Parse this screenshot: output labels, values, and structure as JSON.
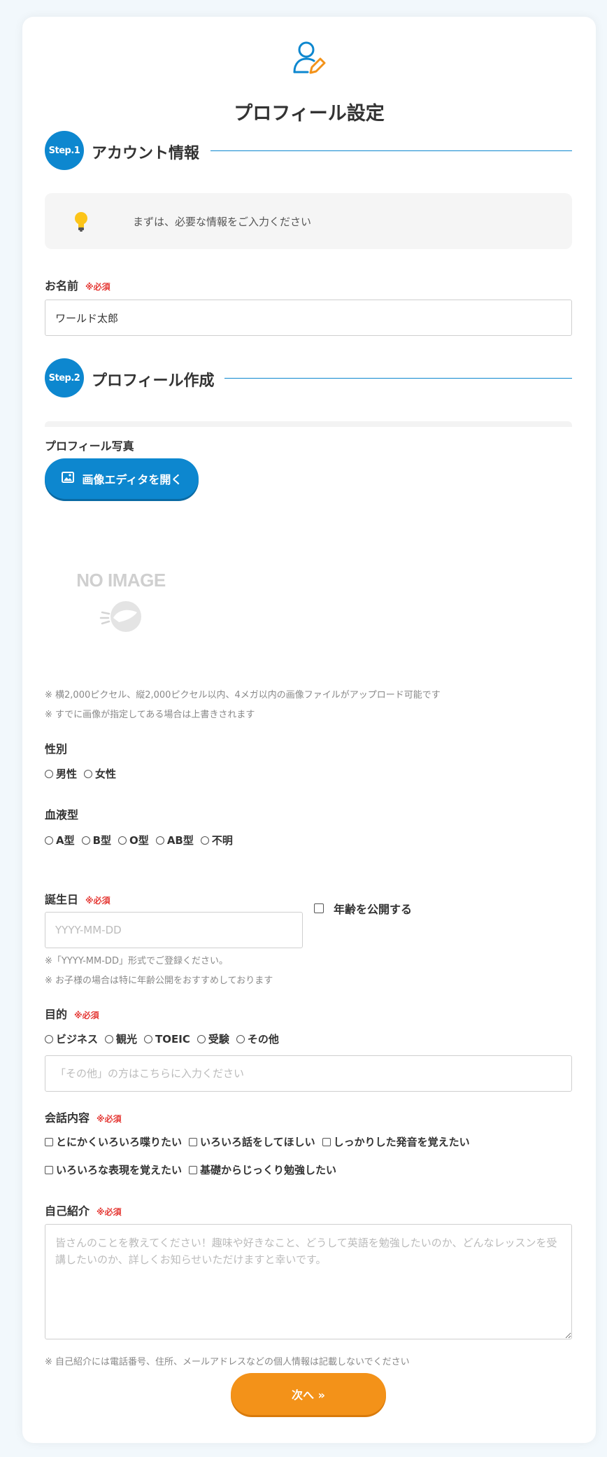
{
  "page": {
    "title": "プロフィール設定",
    "header_icon": "user-edit-icon"
  },
  "colors": {
    "accent": "#0d87cf",
    "required": "#e53935",
    "next_button": "#f39219",
    "background": "#f2f8fc"
  },
  "step1": {
    "badge": "Step.1",
    "title": "アカウント情報"
  },
  "notice": {
    "icon": "lightbulb-icon",
    "text": "まずは、必要な情報をご入力ください"
  },
  "name": {
    "label": "お名前",
    "required": "※必須",
    "value": "ワールド太郎"
  },
  "step2": {
    "badge": "Step.2",
    "title": "プロフィール作成"
  },
  "photo": {
    "label": "プロフィール写真",
    "editor_button": "画像エディタを開く",
    "editor_icon": "image-icon",
    "no_image": "NO IMAGE",
    "note1": "※ 横2,000ピクセル、縦2,000ピクセル以内、4メガ以内の画像ファイルがアップロード可能です",
    "note2": "※ すでに画像が指定してある場合は上書きされます"
  },
  "gender": {
    "label": "性別",
    "options": [
      "男性",
      "女性"
    ]
  },
  "blood": {
    "label": "血液型",
    "options": [
      "A型",
      "B型",
      "O型",
      "AB型",
      "不明"
    ]
  },
  "birthday": {
    "label": "誕生日",
    "required": "※必須",
    "placeholder": "YYYY-MM-DD",
    "age_public": "年齢を公開する",
    "note1": "※「YYYY-MM-DD」形式でご登録ください。",
    "note2": "※ お子様の場合は特に年齢公開をおすすめしております"
  },
  "purpose": {
    "label": "目的",
    "required": "※必須",
    "options": [
      "ビジネス",
      "観光",
      "TOEIC",
      "受験",
      "その他"
    ],
    "other_placeholder": "「その他」の方はこちらに入力ください"
  },
  "conversation": {
    "label": "会話内容",
    "required": "※必須",
    "options": [
      "とにかくいろいろ喋りたい",
      "いろいろ話をしてほしい",
      "しっかりした発音を覚えたい",
      "いろいろな表現を覚えたい",
      "基礎からじっくり勉強したい"
    ]
  },
  "intro": {
    "label": "自己紹介",
    "required": "※必須",
    "placeholder": "皆さんのことを教えてください！趣味や好きなこと、どうして英語を勉強したいのか、どんなレッスンを受講したいのか、詳しくお知らせいただけますと幸いです。",
    "note": "※ 自己紹介には電話番号、住所、メールアドレスなどの個人情報は記載しないでください"
  },
  "next_button": "次へ »"
}
